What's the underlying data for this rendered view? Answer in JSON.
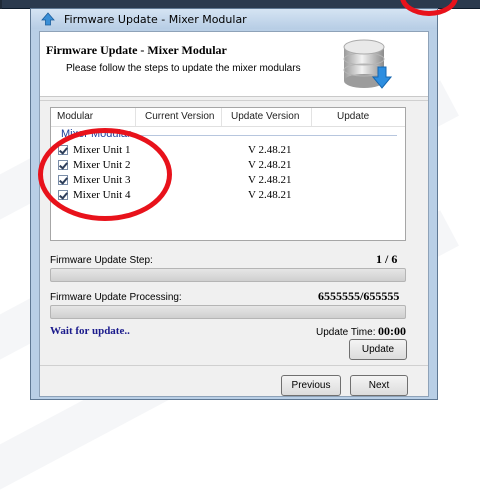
{
  "window": {
    "title": "Firmware Update - Mixer Modular"
  },
  "header": {
    "title": "Firmware Update - Mixer Modular",
    "subtitle": "Please follow the steps to update the mixer modulars"
  },
  "list": {
    "columns": [
      "Modular",
      "Current Version",
      "Update Version",
      "Update"
    ],
    "group": "Mixer Modular",
    "rows": [
      {
        "name": "Mixer Unit 1",
        "update_version": "V 2.48.21",
        "checked": true
      },
      {
        "name": "Mixer Unit 2",
        "update_version": "V 2.48.21",
        "checked": true
      },
      {
        "name": "Mixer Unit 3",
        "update_version": "V 2.48.21",
        "checked": true
      },
      {
        "name": "Mixer Unit 4",
        "update_version": "V 2.48.21",
        "checked": true
      }
    ]
  },
  "step": {
    "label": "Firmware Update Step:",
    "value": "1 / 6",
    "progress": 0
  },
  "processing": {
    "label": "Firmware Update Processing:",
    "value": "6555555/655555",
    "progress": 0
  },
  "status": {
    "message": "Wait for update..",
    "time_label": "Update Time:",
    "time_value": "00:00"
  },
  "buttons": {
    "update": "Update",
    "previous": "Previous",
    "next": "Next"
  },
  "colors": {
    "annotation_circle": "#e8121b",
    "status_text": "#1a1a8c",
    "group_label": "#1e3f9c"
  }
}
